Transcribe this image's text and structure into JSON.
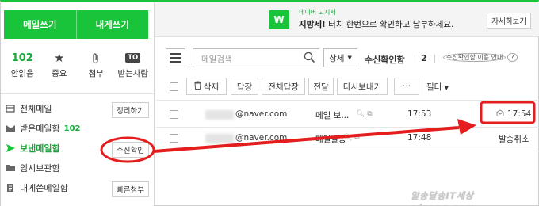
{
  "sidebar": {
    "write_mail": "메일쓰기",
    "write_to_me": "내게쓰기",
    "quick": {
      "unread_count": "102",
      "unread_label": "안읽음",
      "important_label": "중요",
      "attachment_label": "첨부",
      "to_icon_text": "TO",
      "received_label": "받는사람"
    },
    "folders": [
      {
        "label": "전체메일",
        "button": "정리하기"
      },
      {
        "label": "받은메일함",
        "count": "102"
      },
      {
        "label": "보낸메일함",
        "button": "수신확인"
      },
      {
        "label": "임시보관함"
      },
      {
        "label": "내게쓴메일함",
        "button": "빠른첨부"
      }
    ]
  },
  "banner": {
    "small": "네이버 고지서",
    "bold": "지방세!",
    "text": " 터치 한번으로 확인하고 납부하세요.",
    "detail": "자세히보기",
    "icon_text": "W"
  },
  "toolbar": {
    "search_placeholder": "메일검색",
    "detail_select": "상세",
    "folder_title": "수신확인함",
    "count": "2",
    "info_link": "수신확인함 이용 안내",
    "info_q": "?",
    "delete": "삭제",
    "reply": "답장",
    "reply_all": "전체답장",
    "forward": "전달",
    "download": "다시보내기",
    "more": "···",
    "filter": "필터"
  },
  "mails": [
    {
      "recipient": "@naver.com",
      "subject": "메일 보...",
      "sent_time": "17:53",
      "read_status": "17:54"
    },
    {
      "recipient": "@naver.com",
      "subject": "메일발송",
      "sent_time": "17:48",
      "read_status": "발송취소"
    }
  ],
  "watermark": "알송달송IT세상 rdsong.com",
  "colors": {
    "brand_green": "#19c33a",
    "annotation_red": "#e41e1e"
  }
}
